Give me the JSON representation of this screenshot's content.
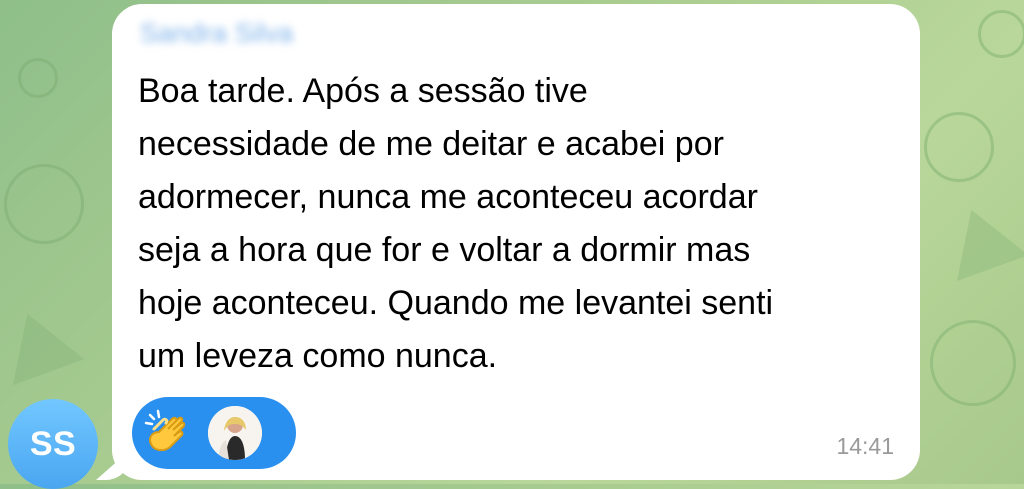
{
  "chat": {
    "avatar_initials": "SS",
    "message": {
      "sender": "Sandra Silva",
      "text": "Boa tarde. Após a sessão tive\nnecessidade de me deitar e acabei por\nadormecer, nunca me aconteceu acordar\nseja a hora que for e voltar a dormir mas\nhoje aconteceu. Quando me levantei senti\num leveza como nunca.",
      "time": "14:41"
    },
    "reaction": {
      "emoji_icon": "clapping-hands-icon",
      "reactor_avatar_icon": "reactor-avatar-icon"
    }
  },
  "colors": {
    "bubble_background": "#ffffff",
    "avatar_background": "#4aa6f0",
    "reaction_pill": "#2a90ef",
    "timestamp_text": "#9a9a9a",
    "wallpaper": "#a9cc90"
  }
}
